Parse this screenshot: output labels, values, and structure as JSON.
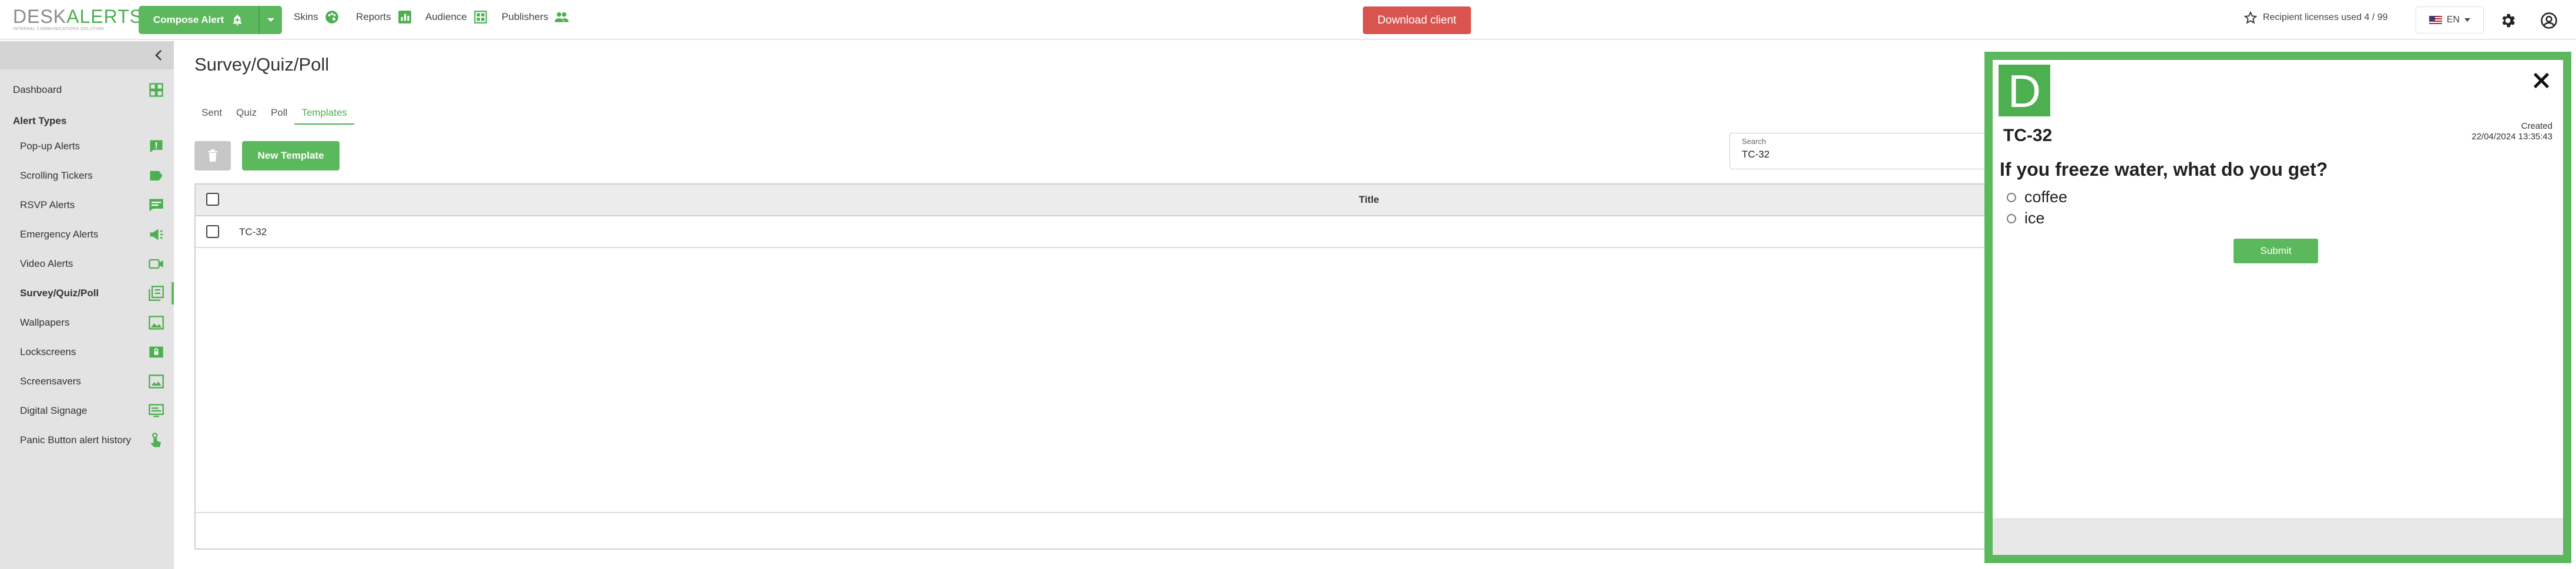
{
  "header": {
    "logo_word_1": "DESK",
    "logo_word_2": "ALERTS",
    "logo_tagline": "INTERNAL COMMUNICATIONS SOLUTION",
    "compose_label": "Compose Alert",
    "nav": [
      {
        "label": "Skins",
        "icon": "palette-icon"
      },
      {
        "label": "Reports",
        "icon": "bar-chart-icon"
      },
      {
        "label": "Audience",
        "icon": "org-chart-icon"
      },
      {
        "label": "Publishers",
        "icon": "people-icon"
      }
    ],
    "download_label": "Download client",
    "licenses_text": "Recipient licenses used 4 / 99",
    "language": "EN"
  },
  "sidebar": {
    "dashboard": "Dashboard",
    "section_title": "Alert Types",
    "items": [
      {
        "label": "Pop-up Alerts",
        "icon": "popup-icon"
      },
      {
        "label": "Scrolling Tickers",
        "icon": "ticker-icon"
      },
      {
        "label": "RSVP Alerts",
        "icon": "chat-icon"
      },
      {
        "label": "Emergency Alerts",
        "icon": "megaphone-icon"
      },
      {
        "label": "Video Alerts",
        "icon": "video-icon"
      },
      {
        "label": "Survey/Quiz/Poll",
        "icon": "survey-icon"
      },
      {
        "label": "Wallpapers",
        "icon": "image-icon"
      },
      {
        "label": "Lockscreens",
        "icon": "lockscreen-icon"
      },
      {
        "label": "Screensavers",
        "icon": "screensaver-icon"
      },
      {
        "label": "Digital Signage",
        "icon": "signage-icon"
      },
      {
        "label": "Panic Button alert history",
        "icon": "hand-pointer-icon"
      }
    ]
  },
  "main": {
    "title": "Survey/Quiz/Poll",
    "tabs": [
      "Sent",
      "Quiz",
      "Poll",
      "Templates"
    ],
    "active_tab": "Templates",
    "new_template_label": "New Template",
    "search_label": "Search",
    "search_value": "TC-32",
    "table": {
      "column_title": "Title",
      "rows": [
        {
          "title": "TC-32"
        }
      ]
    }
  },
  "popup": {
    "logo_letter": "D",
    "title": "TC-32",
    "created_label": "Created",
    "created_value": "22/04/2024 13:35:43",
    "question": "If you freeze water, what do you get?",
    "options": [
      "coffee",
      "ice"
    ],
    "submit_label": "Submit"
  },
  "colors": {
    "brand_green": "#5cb85c",
    "download_red": "#d9534f",
    "sidebar_bg": "#e3e3e3"
  }
}
